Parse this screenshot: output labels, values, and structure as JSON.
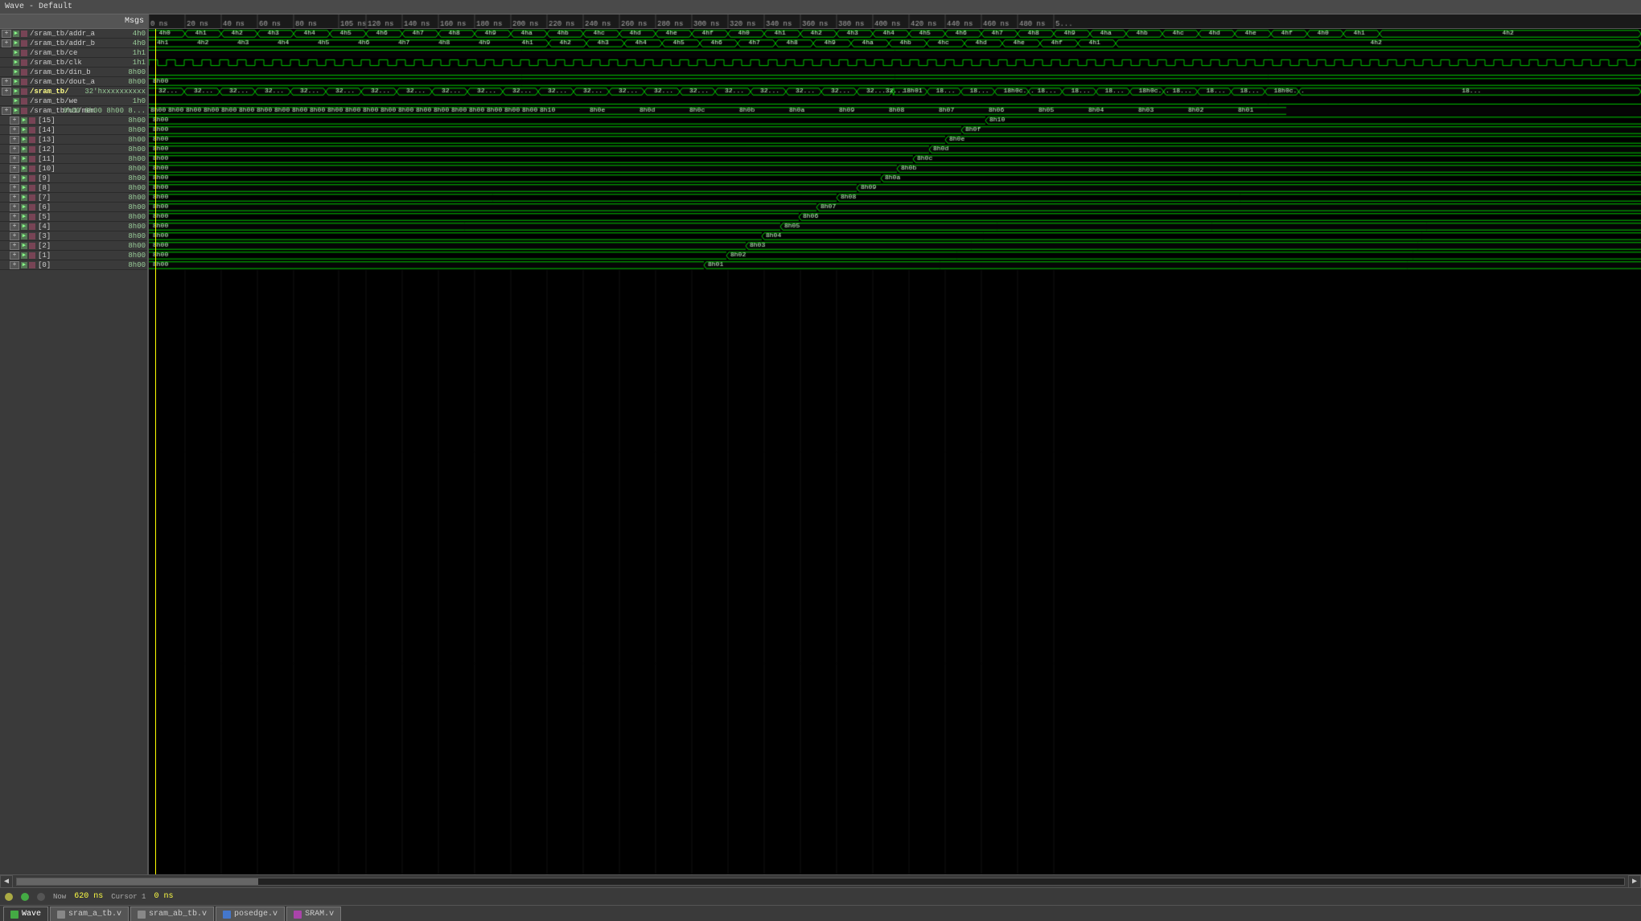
{
  "title_bar": {
    "text": "Wave - Default"
  },
  "signal_panel": {
    "header_label": "Msgs",
    "signals": [
      {
        "indent": 1,
        "expandable": true,
        "name": "/sram_tb/addr_a",
        "value": "4h0"
      },
      {
        "indent": 1,
        "expandable": true,
        "name": "/sram_tb/addr_b",
        "value": "4h0"
      },
      {
        "indent": 1,
        "expandable": false,
        "name": "/sram_tb/ce",
        "value": "1h1"
      },
      {
        "indent": 1,
        "expandable": false,
        "name": "/sram_tb/clk",
        "value": "1h1"
      },
      {
        "indent": 1,
        "expandable": false,
        "name": "/sram_tb/din_b",
        "value": "8h00"
      },
      {
        "indent": 1,
        "expandable": true,
        "name": "/sram_tb/dout_a",
        "value": "8h00"
      },
      {
        "indent": 1,
        "expandable": true,
        "name": "/sram_tb/",
        "value": "32'hxxxxxxxxxx",
        "bold": true
      },
      {
        "indent": 1,
        "expandable": false,
        "name": "/sram_tb/we",
        "value": "1h0"
      },
      {
        "indent": 1,
        "expandable": true,
        "name": "/sram_tb/u1/mem",
        "value": "8h00 8h00 8h00 8..."
      },
      {
        "indent": 2,
        "expandable": true,
        "name": "[15]",
        "value": "8h00"
      },
      {
        "indent": 2,
        "expandable": true,
        "name": "[14]",
        "value": "8h00"
      },
      {
        "indent": 2,
        "expandable": true,
        "name": "[13]",
        "value": "8h00"
      },
      {
        "indent": 2,
        "expandable": true,
        "name": "[12]",
        "value": "8h00"
      },
      {
        "indent": 2,
        "expandable": true,
        "name": "[11]",
        "value": "8h00"
      },
      {
        "indent": 2,
        "expandable": true,
        "name": "[10]",
        "value": "8h00"
      },
      {
        "indent": 2,
        "expandable": true,
        "name": "[9]",
        "value": "8h00"
      },
      {
        "indent": 2,
        "expandable": true,
        "name": "[8]",
        "value": "8h00"
      },
      {
        "indent": 2,
        "expandable": true,
        "name": "[7]",
        "value": "8h00"
      },
      {
        "indent": 2,
        "expandable": true,
        "name": "[6]",
        "value": "8h00"
      },
      {
        "indent": 2,
        "expandable": true,
        "name": "[5]",
        "value": "8h00"
      },
      {
        "indent": 2,
        "expandable": true,
        "name": "[4]",
        "value": "8h00"
      },
      {
        "indent": 2,
        "expandable": true,
        "name": "[3]",
        "value": "8h00"
      },
      {
        "indent": 2,
        "expandable": true,
        "name": "[2]",
        "value": "8h00"
      },
      {
        "indent": 2,
        "expandable": true,
        "name": "[1]",
        "value": "8h00"
      },
      {
        "indent": 2,
        "expandable": true,
        "name": "[0]",
        "value": "8h00"
      }
    ]
  },
  "status_bar": {
    "now_label": "Now",
    "now_value": "620 ns",
    "cursor_label": "Cursor 1",
    "cursor_value": "0 ns"
  },
  "time_ruler": {
    "start": "0 ns",
    "markers": [
      "20 ns",
      "40 ns",
      "60 ns",
      "80 ns",
      "105 ns",
      "120 ns",
      "140 ns",
      "160 ns",
      "180 ns",
      "200 ns",
      "220 ns",
      "240 ns",
      "260 ns",
      "280 ns",
      "300 ns",
      "320 ns",
      "340 ns",
      "360 ns",
      "380 ns",
      "400 ns",
      "420 ns",
      "440 ns",
      "460 ns",
      "480 ns",
      "5..."
    ]
  },
  "tabs": [
    {
      "label": "Wave",
      "active": true,
      "icon": "wave"
    },
    {
      "label": "sram_a_tb.v",
      "active": false,
      "icon": "file"
    },
    {
      "label": "sram_ab_tb.v",
      "active": false,
      "icon": "file"
    },
    {
      "label": "posedge.v",
      "active": false,
      "icon": "file-blue"
    },
    {
      "label": "SRAM.v",
      "active": false,
      "icon": "file-purple"
    }
  ]
}
